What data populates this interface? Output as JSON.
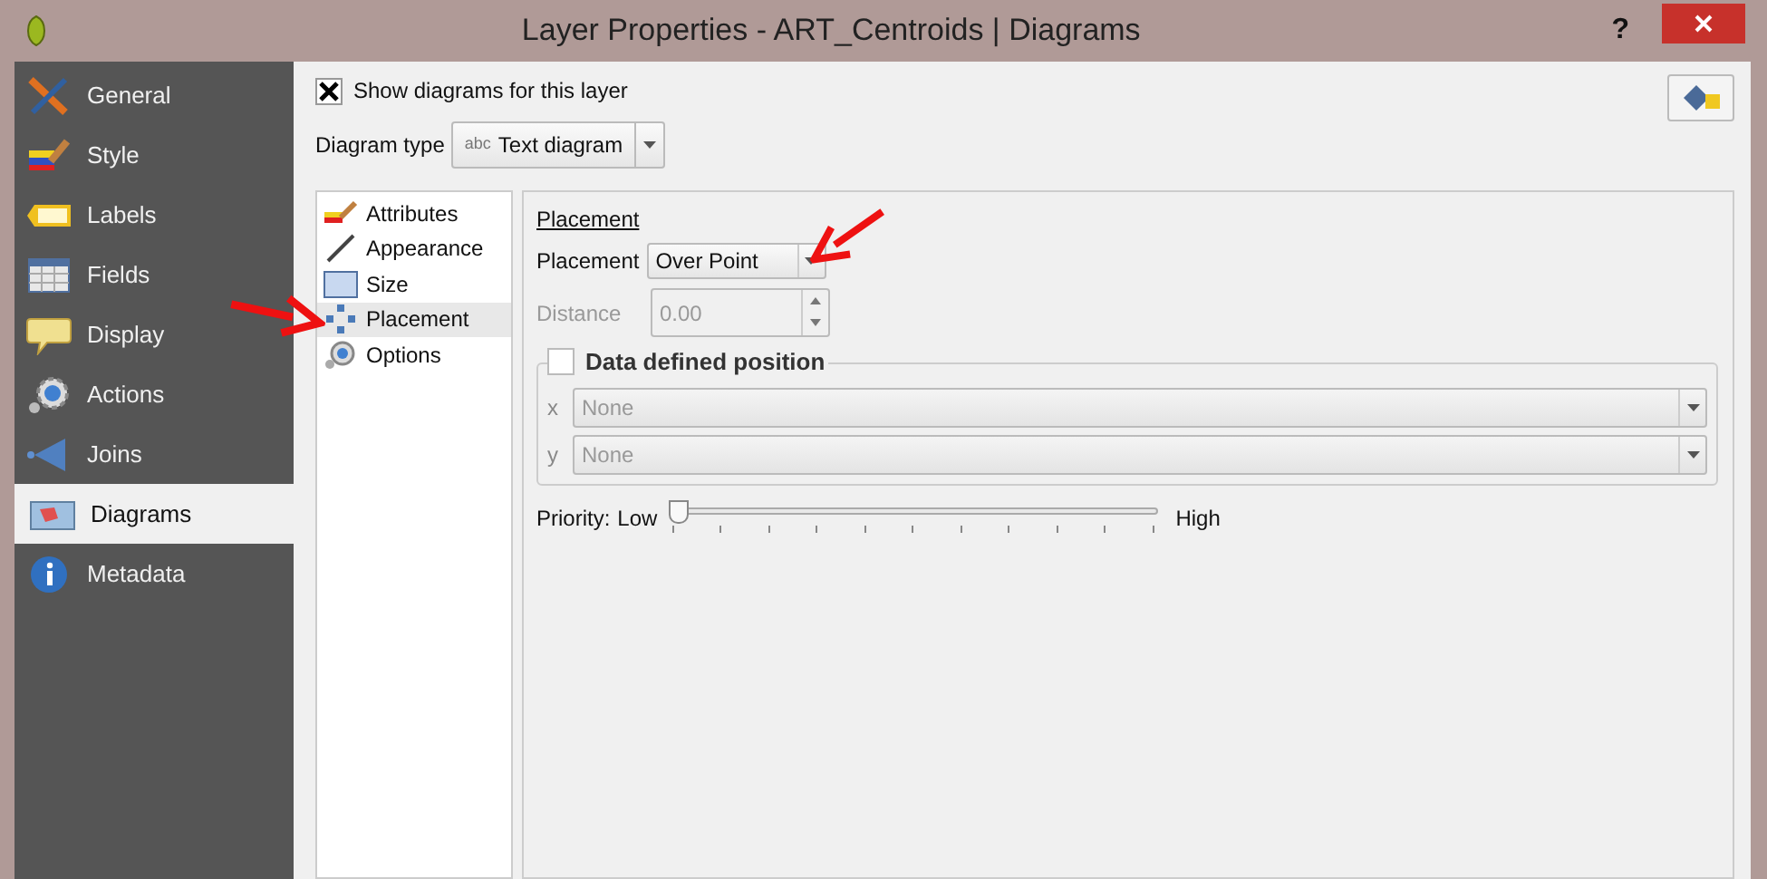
{
  "window": {
    "title": "Layer Properties - ART_Centroids | Diagrams",
    "help": "?"
  },
  "sidebar": {
    "items": [
      {
        "label": "General",
        "selected": false
      },
      {
        "label": "Style",
        "selected": false
      },
      {
        "label": "Labels",
        "selected": false
      },
      {
        "label": "Fields",
        "selected": false
      },
      {
        "label": "Display",
        "selected": false
      },
      {
        "label": "Actions",
        "selected": false
      },
      {
        "label": "Joins",
        "selected": false
      },
      {
        "label": "Diagrams",
        "selected": true
      },
      {
        "label": "Metadata",
        "selected": false
      }
    ]
  },
  "show_diagrams": {
    "label": "Show diagrams for this layer",
    "checked": true
  },
  "diagram_type": {
    "label": "Diagram type",
    "badge": "abc",
    "value": "Text diagram"
  },
  "sections": [
    {
      "label": "Attributes",
      "selected": false
    },
    {
      "label": "Appearance",
      "selected": false
    },
    {
      "label": "Size",
      "selected": false
    },
    {
      "label": "Placement",
      "selected": true
    },
    {
      "label": "Options",
      "selected": false
    }
  ],
  "placement": {
    "heading": "Placement",
    "label": "Placement",
    "value": "Over Point",
    "distance": {
      "label": "Distance",
      "value": "0.00",
      "disabled": true
    },
    "data_defined": {
      "label": "Data defined position",
      "checked": false,
      "fields": [
        {
          "label": "x",
          "value": "None"
        },
        {
          "label": "y",
          "value": "None"
        }
      ]
    },
    "priority": {
      "label": "Priority:",
      "low": "Low",
      "high": "High",
      "level": 0
    }
  }
}
